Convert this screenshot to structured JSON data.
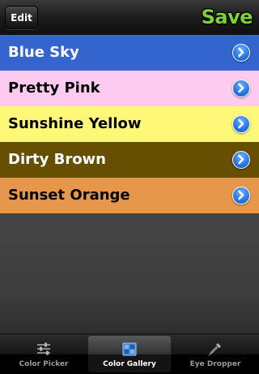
{
  "navbar": {
    "edit_label": "Edit",
    "save_label": "Save"
  },
  "colors": [
    {
      "name": "Blue Sky",
      "background": "#3465cf",
      "text": "#ffffff"
    },
    {
      "name": "Pretty Pink",
      "background": "#fdcbf0",
      "text": "#000000"
    },
    {
      "name": "Sunshine Yellow",
      "background": "#fdf878",
      "text": "#000000"
    },
    {
      "name": "Dirty Brown",
      "background": "#664f00",
      "text": "#ffffff"
    },
    {
      "name": "Sunset Orange",
      "background": "#e6974b",
      "text": "#000000"
    }
  ],
  "tabbar": {
    "tabs": [
      {
        "label": "Color Picker",
        "icon": "sliders-icon",
        "selected": false
      },
      {
        "label": "Color Gallery",
        "icon": "gallery-icon",
        "selected": true
      },
      {
        "label": "Eye Dropper",
        "icon": "eyedropper-icon",
        "selected": false
      }
    ]
  },
  "theme": {
    "accent_save": "#7cd336",
    "disclosure_blue": "#2a7ae6"
  }
}
